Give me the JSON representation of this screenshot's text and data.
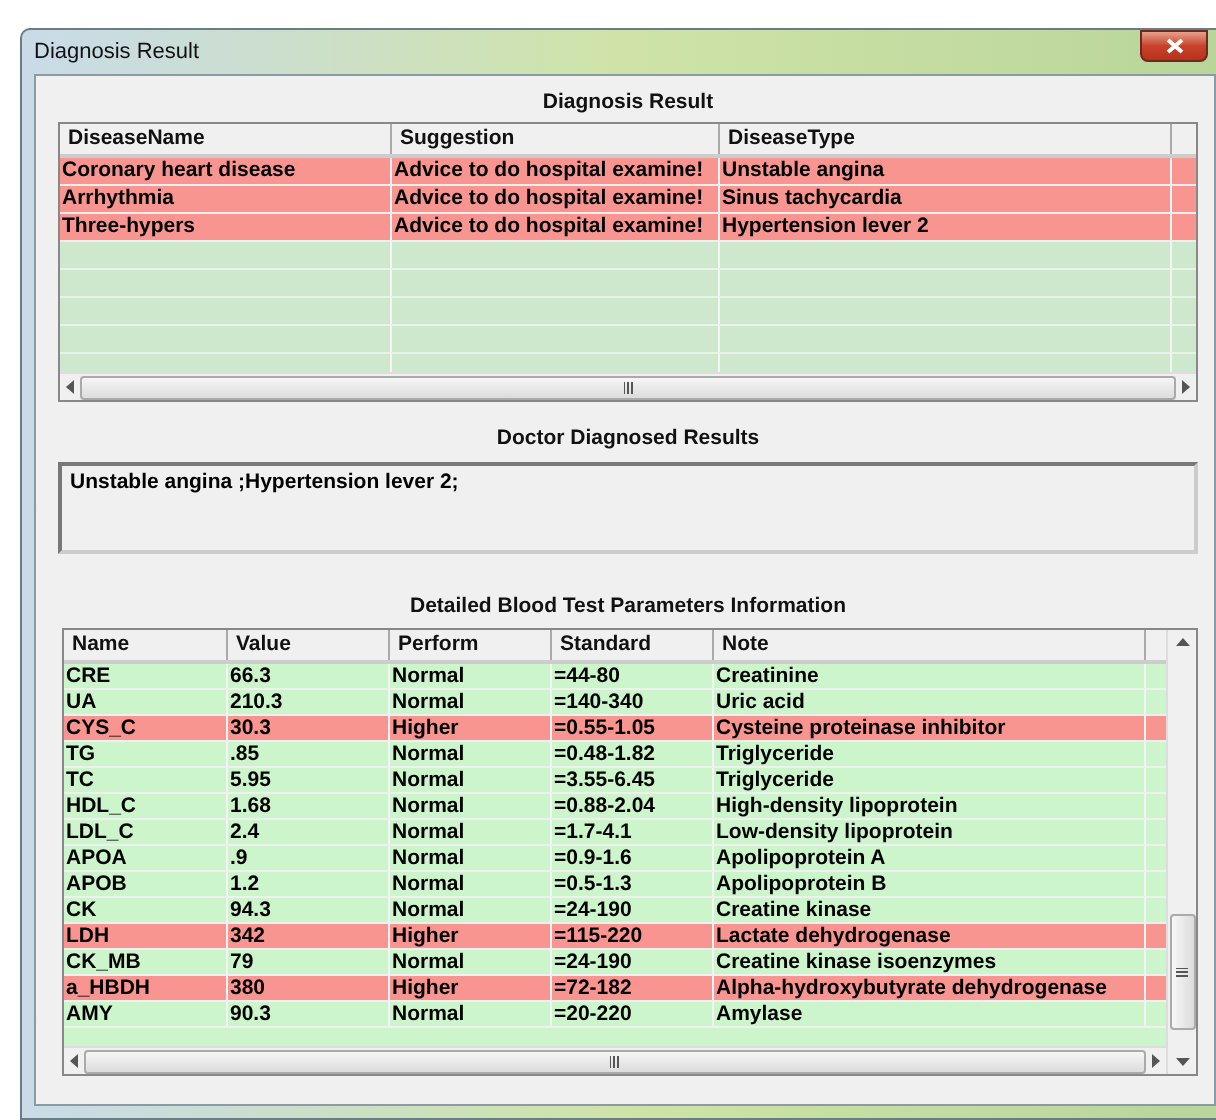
{
  "window": {
    "title": "Diagnosis Result"
  },
  "diagnosis": {
    "heading": "Diagnosis Result",
    "columns": [
      "DiseaseName",
      "Suggestion",
      "DiseaseType"
    ],
    "rows": [
      {
        "cells": [
          "Coronary heart disease",
          "Advice to do hospital examine!",
          "Unstable angina"
        ],
        "abnormal": true
      },
      {
        "cells": [
          "Arrhythmia",
          "Advice to do hospital examine!",
          "Sinus tachycardia"
        ],
        "abnormal": true
      },
      {
        "cells": [
          "Three-hypers",
          "Advice to do hospital examine!",
          "Hypertension lever 2"
        ],
        "abnormal": true
      }
    ]
  },
  "doctor": {
    "heading": "Doctor Diagnosed Results",
    "value": "Unstable angina ;Hypertension lever 2;"
  },
  "blood_tests": {
    "heading": "Detailed Blood Test Parameters Information",
    "columns": [
      "Name",
      "Value",
      "Perform",
      "Standard",
      "Note"
    ],
    "rows": [
      {
        "cells": [
          "CRE",
          "66.3",
          "Normal",
          "=44-80",
          "Creatinine"
        ],
        "abnormal": false
      },
      {
        "cells": [
          "UA",
          "210.3",
          "Normal",
          "=140-340",
          "Uric acid"
        ],
        "abnormal": false
      },
      {
        "cells": [
          "CYS_C",
          "30.3",
          "Higher",
          "=0.55-1.05",
          "Cysteine proteinase inhibitor"
        ],
        "abnormal": true
      },
      {
        "cells": [
          "TG",
          ".85",
          "Normal",
          "=0.48-1.82",
          "Triglyceride"
        ],
        "abnormal": false
      },
      {
        "cells": [
          "TC",
          "5.95",
          "Normal",
          "=3.55-6.45",
          "Triglyceride"
        ],
        "abnormal": false
      },
      {
        "cells": [
          "HDL_C",
          "1.68",
          "Normal",
          "=0.88-2.04",
          "High-density lipoprotein"
        ],
        "abnormal": false
      },
      {
        "cells": [
          "LDL_C",
          "2.4",
          "Normal",
          "=1.7-4.1",
          "Low-density lipoprotein"
        ],
        "abnormal": false
      },
      {
        "cells": [
          "APOA",
          ".9",
          "Normal",
          "=0.9-1.6",
          "Apolipoprotein A"
        ],
        "abnormal": false
      },
      {
        "cells": [
          "APOB",
          "1.2",
          "Normal",
          "=0.5-1.3",
          "Apolipoprotein B"
        ],
        "abnormal": false
      },
      {
        "cells": [
          "CK",
          "94.3",
          "Normal",
          "=24-190",
          "Creatine kinase"
        ],
        "abnormal": false
      },
      {
        "cells": [
          "LDH",
          "342",
          "Higher",
          "=115-220",
          "Lactate dehydrogenase"
        ],
        "abnormal": true
      },
      {
        "cells": [
          "CK_MB",
          "79",
          "Normal",
          "=24-190",
          "Creatine kinase isoenzymes"
        ],
        "abnormal": false
      },
      {
        "cells": [
          "a_HBDH",
          "380",
          "Higher",
          "=72-182",
          "Alpha-hydroxybutyrate dehydrogenase"
        ],
        "abnormal": true
      },
      {
        "cells": [
          "AMY",
          "90.3",
          "Normal",
          "=20-220",
          "Amylase"
        ],
        "abnormal": false
      }
    ]
  }
}
